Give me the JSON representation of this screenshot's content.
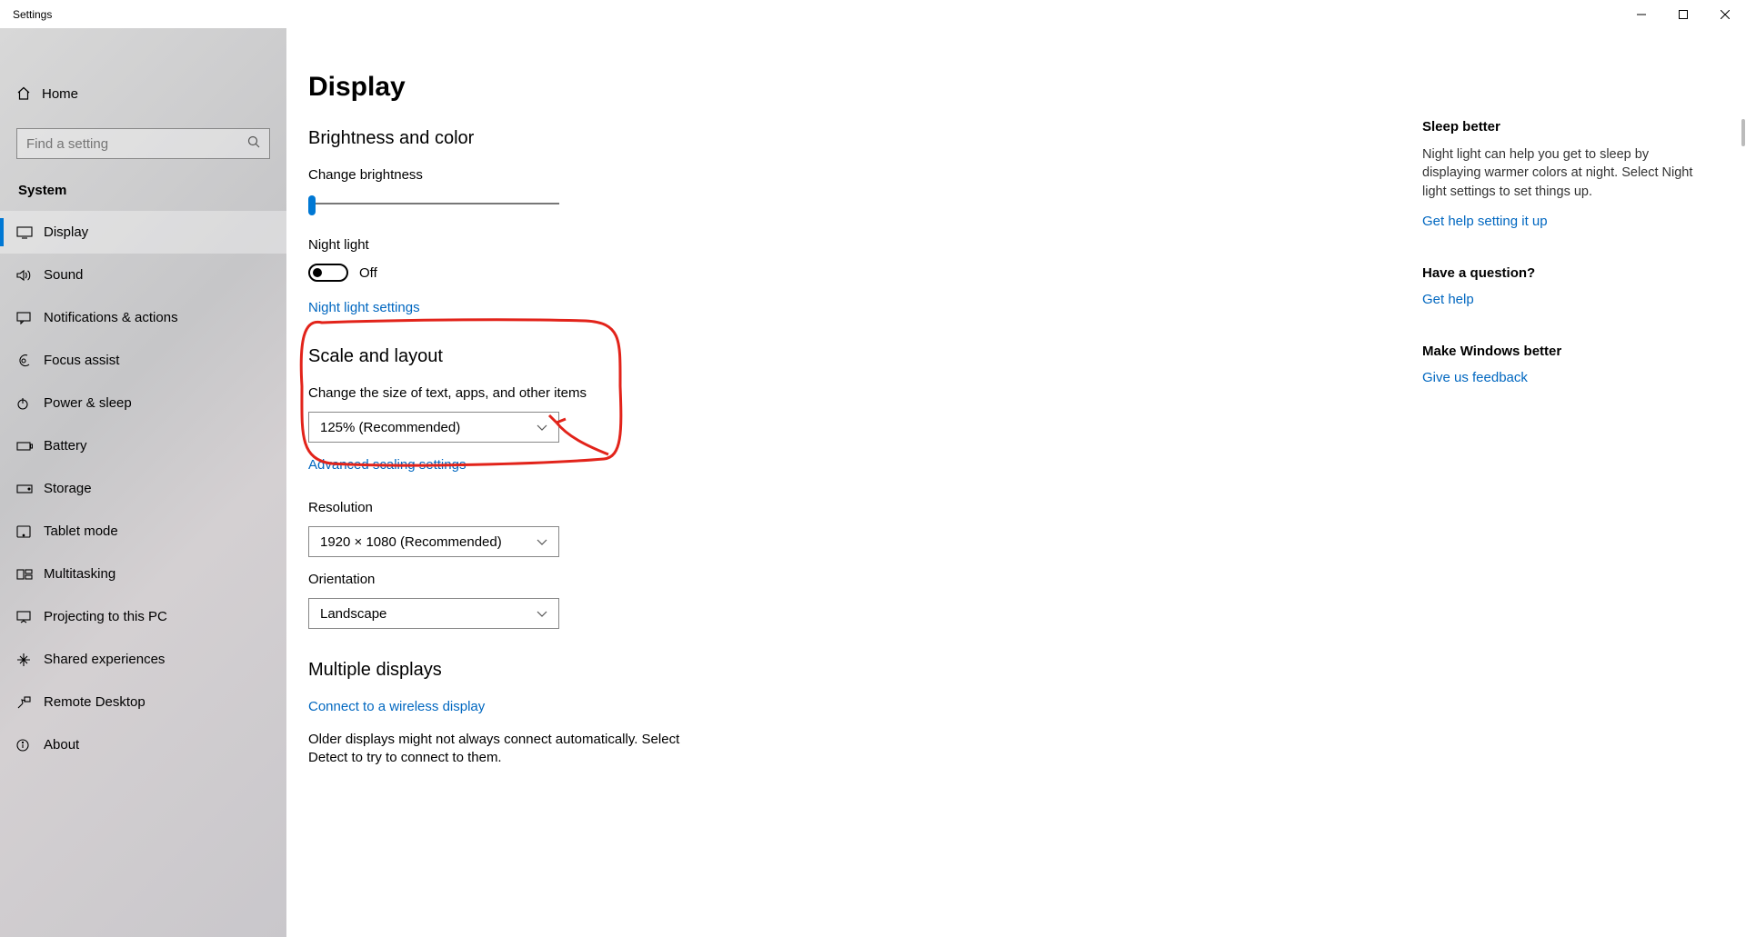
{
  "window": {
    "title": "Settings"
  },
  "sidebar": {
    "home": "Home",
    "search_placeholder": "Find a setting",
    "section": "System",
    "items": [
      {
        "label": "Display",
        "icon": "display-icon",
        "active": true
      },
      {
        "label": "Sound",
        "icon": "sound-icon"
      },
      {
        "label": "Notifications & actions",
        "icon": "notifications-icon"
      },
      {
        "label": "Focus assist",
        "icon": "focus-assist-icon"
      },
      {
        "label": "Power & sleep",
        "icon": "power-icon"
      },
      {
        "label": "Battery",
        "icon": "battery-icon"
      },
      {
        "label": "Storage",
        "icon": "storage-icon"
      },
      {
        "label": "Tablet mode",
        "icon": "tablet-icon"
      },
      {
        "label": "Multitasking",
        "icon": "multitasking-icon"
      },
      {
        "label": "Projecting to this PC",
        "icon": "projecting-icon"
      },
      {
        "label": "Shared experiences",
        "icon": "shared-icon"
      },
      {
        "label": "Remote Desktop",
        "icon": "remote-icon"
      },
      {
        "label": "About",
        "icon": "about-icon"
      }
    ]
  },
  "page": {
    "title": "Display",
    "brightness_section": "Brightness and color",
    "brightness_label": "Change brightness",
    "night_light_label": "Night light",
    "night_light_state": "Off",
    "night_light_link": "Night light settings",
    "scale_section": "Scale and layout",
    "scale_label": "Change the size of text, apps, and other items",
    "scale_value": "125% (Recommended)",
    "advanced_scaling_link": "Advanced scaling settings",
    "resolution_label": "Resolution",
    "resolution_value": "1920 × 1080 (Recommended)",
    "orientation_label": "Orientation",
    "orientation_value": "Landscape",
    "multiple_section": "Multiple displays",
    "wireless_link": "Connect to a wireless display",
    "older_displays_text": "Older displays might not always connect automatically. Select Detect to try to connect to them."
  },
  "right": {
    "sleep_heading": "Sleep better",
    "sleep_text": "Night light can help you get to sleep by displaying warmer colors at night. Select Night light settings to set things up.",
    "sleep_link": "Get help setting it up",
    "question_heading": "Have a question?",
    "question_link": "Get help",
    "feedback_heading": "Make Windows better",
    "feedback_link": "Give us feedback"
  }
}
